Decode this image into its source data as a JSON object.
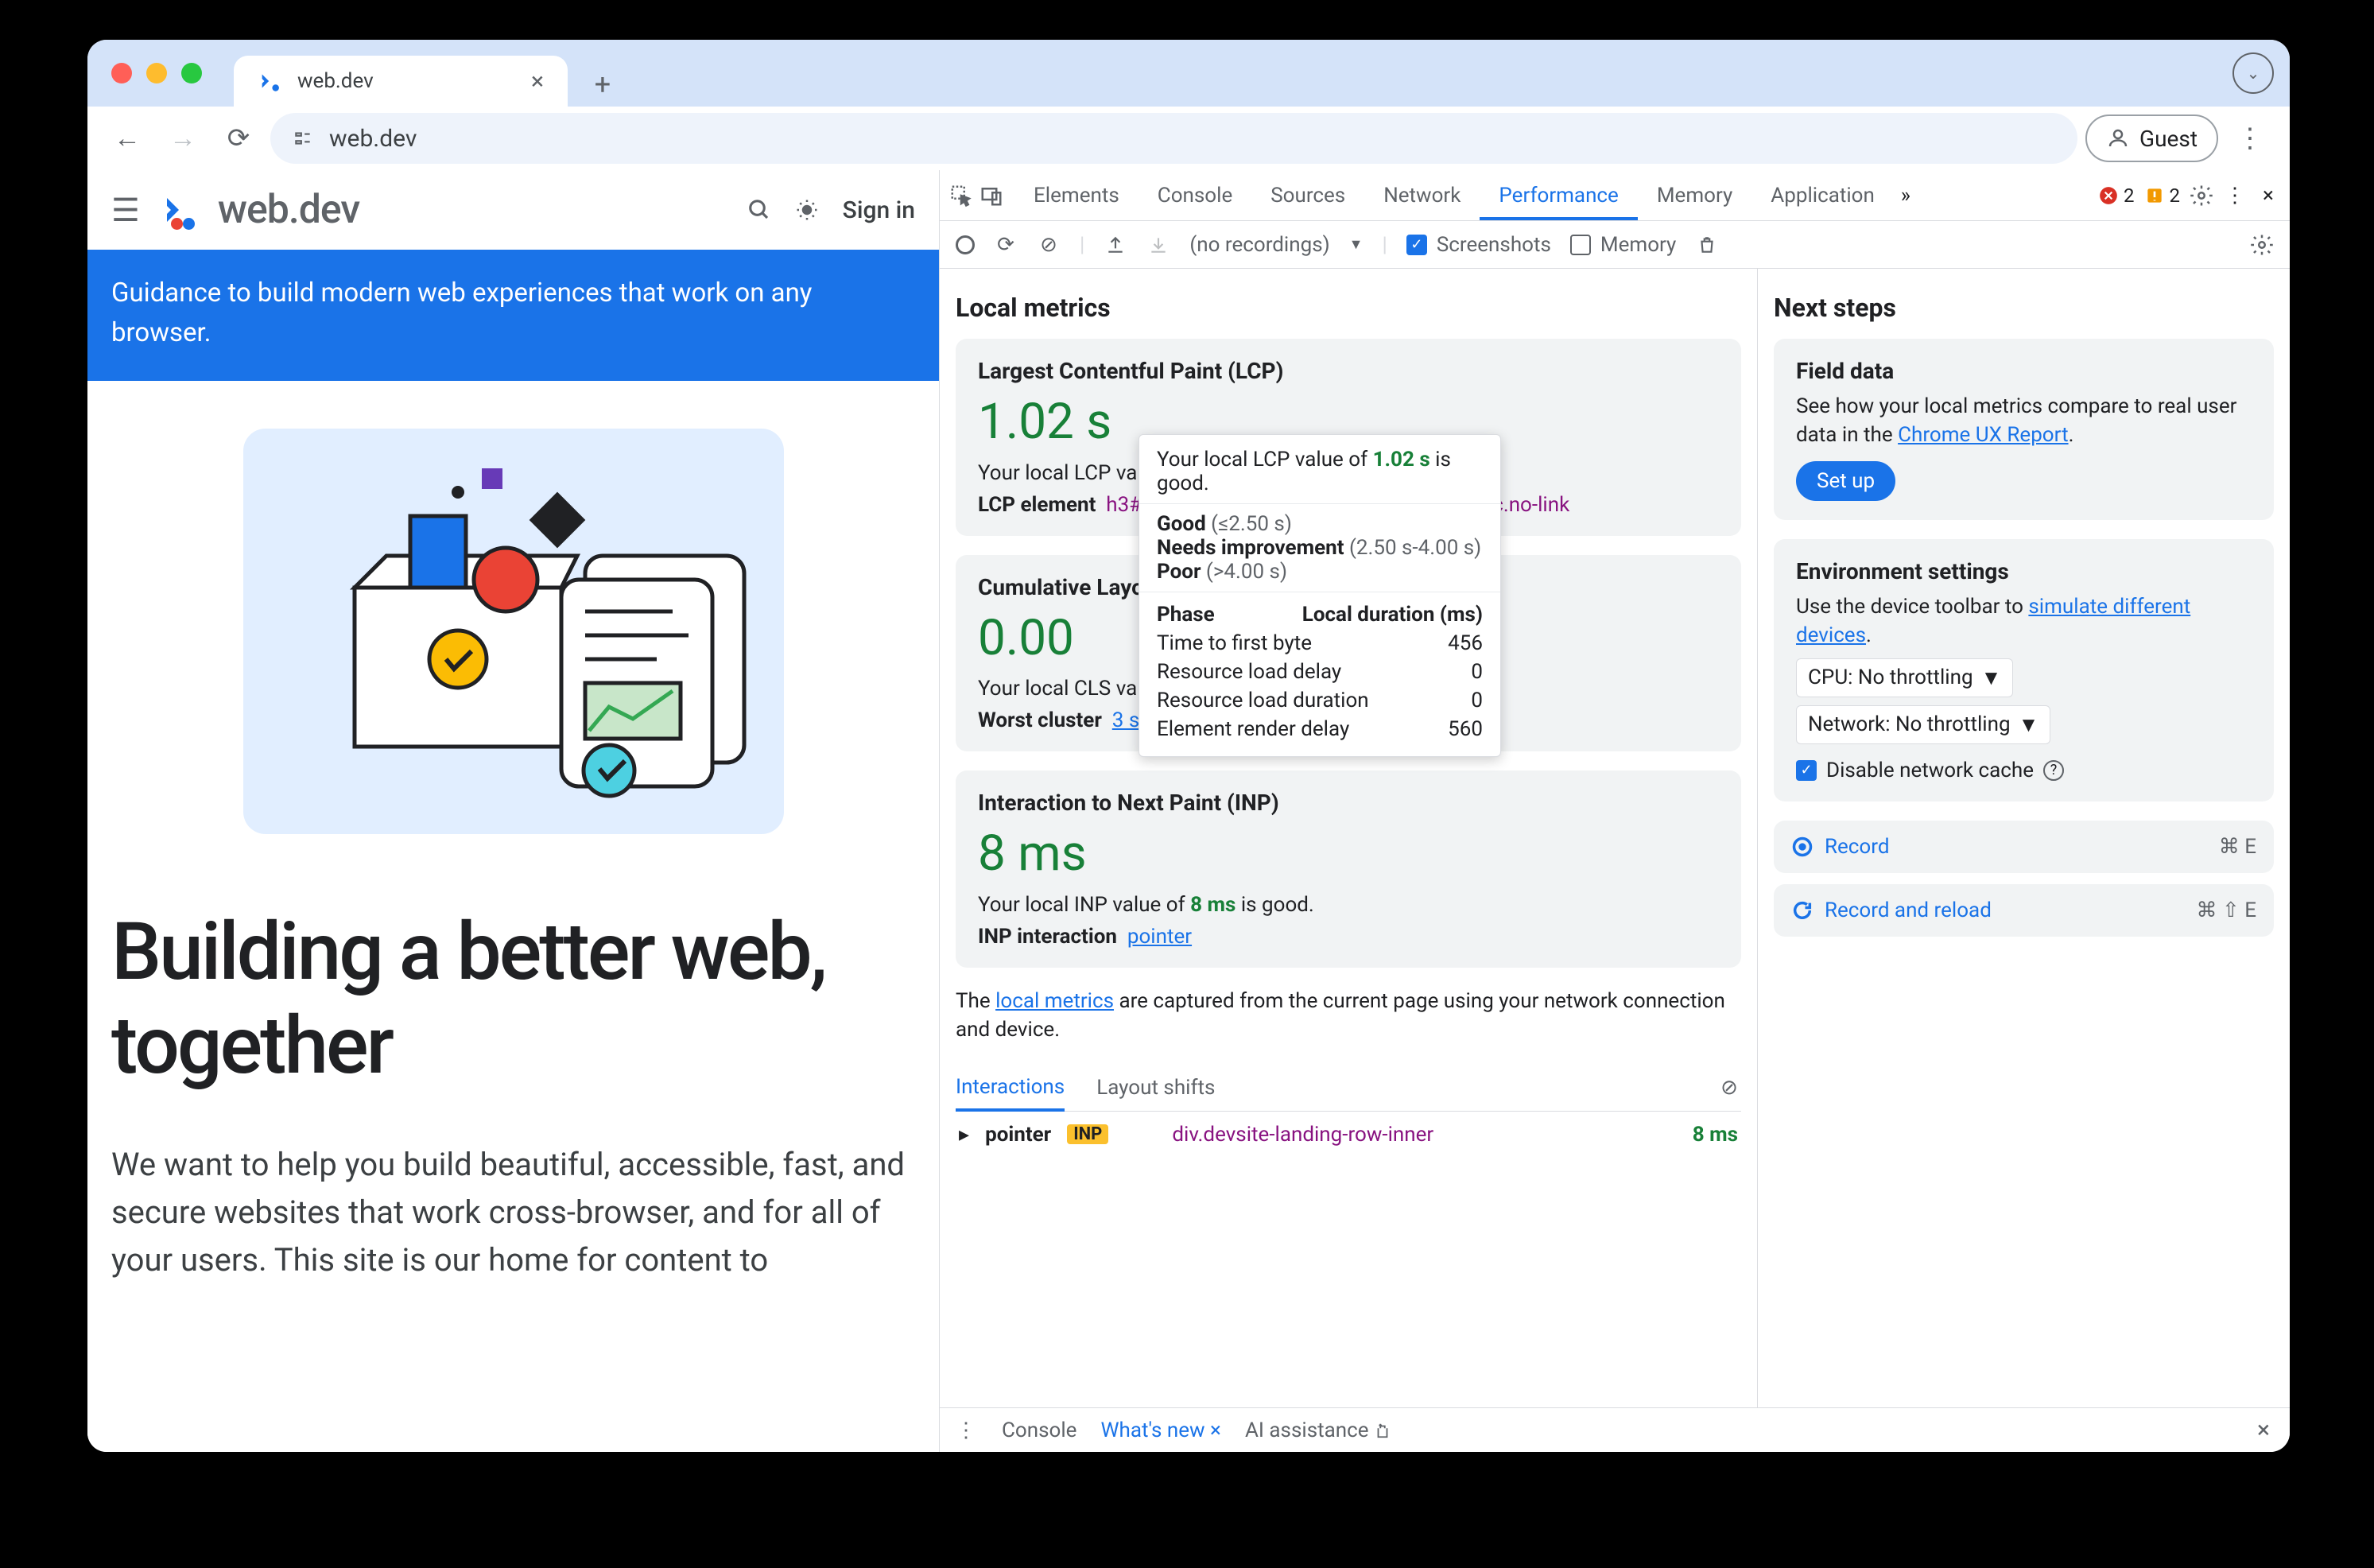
{
  "browser": {
    "tab_title": "web.dev",
    "omnibox": "web.dev",
    "profile": "Guest"
  },
  "page": {
    "logo_text": "web.dev",
    "sign_in": "Sign in",
    "banner": "Guidance to build modern web experiences that work on any browser.",
    "hero_title": "Building a better web, together",
    "hero_body": "We want to help you build beautiful, accessible, fast, and secure websites that work cross-browser, and for all of your users. This site is our home for content to"
  },
  "devtools": {
    "tabs": [
      "Elements",
      "Console",
      "Sources",
      "Network",
      "Performance",
      "Memory",
      "Application"
    ],
    "active_tab": "Performance",
    "errors": "2",
    "warnings": "2",
    "subtoolbar": {
      "recordings": "(no recordings)",
      "screenshots_label": "Screenshots",
      "memory_label": "Memory"
    },
    "left": {
      "heading": "Local metrics",
      "lcp": {
        "title": "Largest Contentful Paint (LCP)",
        "value": "1.02 s",
        "desc_prefix": "Your local LCP valu",
        "element_label": "LCP element",
        "element_tag": "h3#b",
        "element_suffix": ".toc.no-link"
      },
      "tooltip": {
        "line1_pre": "Your local LCP value of ",
        "line1_val": "1.02 s",
        "line1_post": " is good.",
        "good": "Good",
        "good_range": "(≤2.50 s)",
        "ni": "Needs improvement",
        "ni_range": "(2.50 s-4.00 s)",
        "poor": "Poor",
        "poor_range": "(>4.00 s)",
        "phase": "Phase",
        "duration": "Local duration (ms)",
        "rows": [
          {
            "label": "Time to first byte",
            "value": "456"
          },
          {
            "label": "Resource load delay",
            "value": "0"
          },
          {
            "label": "Resource load duration",
            "value": "0"
          },
          {
            "label": "Element render delay",
            "value": "560"
          }
        ]
      },
      "cls": {
        "title": "Cumulative Layo",
        "value": "0.00",
        "desc": "Your local CLS valu",
        "cluster_label": "Worst cluster",
        "cluster_link": "3 shifts"
      },
      "inp": {
        "title": "Interaction to Next Paint (INP)",
        "value": "8 ms",
        "desc_pre": "Your local INP value of ",
        "desc_val": "8 ms",
        "desc_post": " is good.",
        "interaction_label": "INP interaction",
        "interaction_link": "pointer"
      },
      "note_pre": "The ",
      "note_link": "local metrics",
      "note_post": " are captured from the current page using your network connection and device.",
      "subtabs": [
        "Interactions",
        "Layout shifts"
      ],
      "int_row": {
        "kind": "pointer",
        "badge": "INP",
        "element": "div.devsite-landing-row-inner",
        "value": "8 ms"
      }
    },
    "right": {
      "heading": "Next steps",
      "field": {
        "title": "Field data",
        "text_pre": "See how your local metrics compare to real user data in the ",
        "link": "Chrome UX Report",
        "btn": "Set up"
      },
      "env": {
        "title": "Environment settings",
        "text_pre": "Use the device toolbar to ",
        "link": "simulate different devices",
        "cpu": "CPU: No throttling",
        "net": "Network: No throttling",
        "disable_cache": "Disable network cache"
      },
      "record": {
        "label": "Record",
        "kbd": "⌘ E"
      },
      "reload": {
        "label": "Record and reload",
        "kbd": "⌘ ⇧ E"
      }
    },
    "footer": {
      "items": [
        "Console",
        "What's new",
        "AI assistance"
      ]
    }
  }
}
